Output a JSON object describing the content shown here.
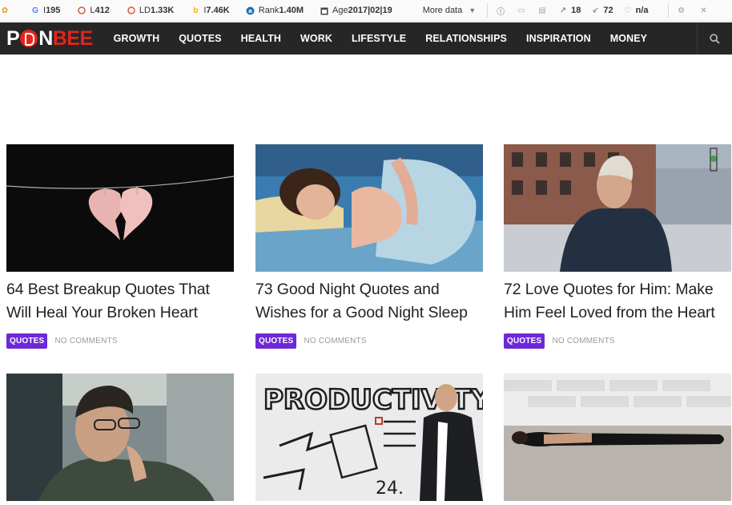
{
  "seo_bar": {
    "google_label": "I",
    "google_value": "195",
    "links_label": "L",
    "links_value": "412",
    "ld_label": "LD",
    "ld_value": "1.33K",
    "bing_label": "I",
    "bing_value": "7.46K",
    "rank_label": "Rank",
    "rank_value": "1.40M",
    "age_label": "Age",
    "age_value": "2017|02|19",
    "more_data": "More data",
    "ext_links": "18",
    "int_links": "72",
    "nofollow": "n/a"
  },
  "site": {
    "logo_left": "P",
    "logo_mid": "N",
    "logo_right": "BEE",
    "nav": [
      "GROWTH",
      "QUOTES",
      "HEALTH",
      "WORK",
      "LIFESTYLE",
      "RELATIONSHIPS",
      "INSPIRATION",
      "MONEY"
    ]
  },
  "articles": [
    {
      "title": "64 Best Breakup Quotes That Will Heal Your Broken Heart",
      "category": "QUOTES",
      "comments": "NO COMMENTS",
      "image": "broken-heart-on-string"
    },
    {
      "title": "73 Good Night Quotes and Wishes for a Good Night Sleep",
      "category": "QUOTES",
      "comments": "NO COMMENTS",
      "image": "woman-sleeping-pillow"
    },
    {
      "title": "72 Love Quotes for Him: Make Him Feel Loved from the Heart",
      "category": "QUOTES",
      "comments": "NO COMMENTS",
      "image": "man-on-street"
    },
    {
      "title": "",
      "category": "",
      "comments": "",
      "image": "man-thinking-glasses"
    },
    {
      "title": "",
      "category": "",
      "comments": "",
      "image": "productivity-wall-man-phone"
    },
    {
      "title": "",
      "category": "",
      "comments": "",
      "image": "woman-lying-on-floor"
    }
  ],
  "colors": {
    "accent": "#6d28d9",
    "nav_bg": "#262626",
    "logo_red": "#e1251b"
  }
}
